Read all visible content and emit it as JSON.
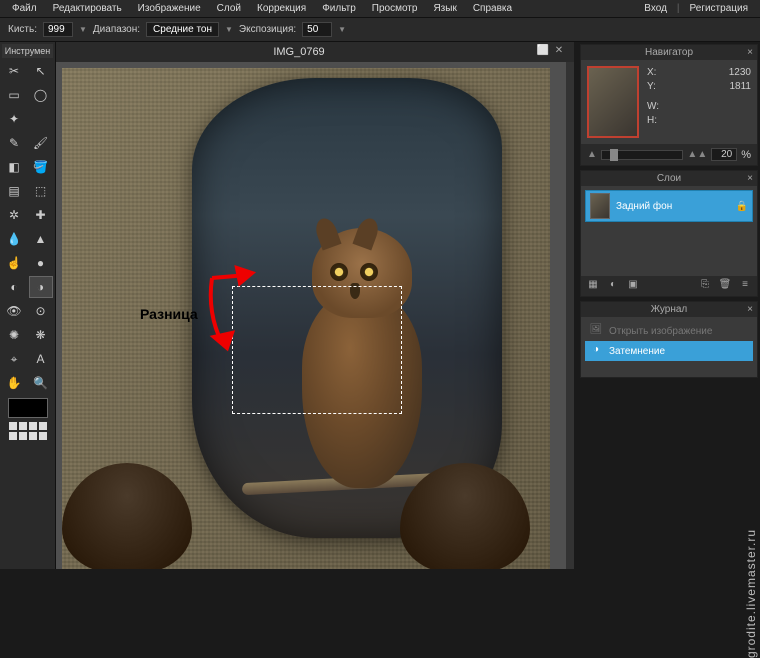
{
  "menus": [
    "Файл",
    "Редактировать",
    "Изображение",
    "Слой",
    "Коррекция",
    "Фильтр",
    "Просмотр",
    "Язык",
    "Справка"
  ],
  "auth": {
    "login": "Вход",
    "reg": "Регистрация"
  },
  "options": {
    "brush_lbl": "Кисть:",
    "brush_val": "999",
    "range_lbl": "Диапазон:",
    "range_val": "Средние тон",
    "exposure_lbl": "Экспозиция:",
    "exposure_val": "50"
  },
  "toolbox_title": "Инструмен",
  "tools": [
    {
      "n": "crop",
      "g": "✂",
      "i": true
    },
    {
      "n": "move",
      "g": "↖",
      "i": true
    },
    {
      "n": "marquee",
      "g": "▭",
      "i": true
    },
    {
      "n": "lasso",
      "g": "◯",
      "i": true
    },
    {
      "n": "wand",
      "g": "✦",
      "i": true
    },
    {
      "n": "blank1",
      "g": "",
      "i": false
    },
    {
      "n": "pencil",
      "g": "✎",
      "i": true
    },
    {
      "n": "brush",
      "g": "🖌",
      "i": true
    },
    {
      "n": "eraser",
      "g": "◧",
      "i": true
    },
    {
      "n": "bucket",
      "g": "🪣",
      "i": true
    },
    {
      "n": "gradient",
      "g": "▤",
      "i": true
    },
    {
      "n": "clone",
      "g": "⬚",
      "i": true
    },
    {
      "n": "stamp",
      "g": "✲",
      "i": true
    },
    {
      "n": "heal",
      "g": "✚",
      "i": true
    },
    {
      "n": "blur",
      "g": "💧",
      "i": true
    },
    {
      "n": "sharpen",
      "g": "▲",
      "i": true
    },
    {
      "n": "smudge",
      "g": "☝",
      "i": true
    },
    {
      "n": "sponge",
      "g": "●",
      "i": true
    },
    {
      "n": "dodge",
      "g": "◐",
      "i": true
    },
    {
      "n": "burn",
      "g": "◑",
      "i": true,
      "active": true
    },
    {
      "n": "eye",
      "g": "👁",
      "i": true
    },
    {
      "n": "redeye",
      "g": "⊙",
      "i": true
    },
    {
      "n": "spot",
      "g": "✺",
      "i": true
    },
    {
      "n": "bloat",
      "g": "❋",
      "i": true
    },
    {
      "n": "picker",
      "g": "⌖",
      "i": true
    },
    {
      "n": "type",
      "g": "A",
      "i": true
    },
    {
      "n": "hand",
      "g": "✋",
      "i": true
    },
    {
      "n": "zoom",
      "g": "🔍",
      "i": true
    }
  ],
  "doc_title": "IMG_0769",
  "annotation": "Разница",
  "navigator": {
    "title": "Навигатор",
    "x_lbl": "X:",
    "x": "1230",
    "y_lbl": "Y:",
    "y": "1811",
    "w_lbl": "W:",
    "h_lbl": "H:",
    "zoom": "20",
    "pct": "%"
  },
  "layers": {
    "title": "Слои",
    "bg": "Задний фон"
  },
  "history": {
    "title": "Журнал",
    "open": "Открыть изображение",
    "burn": "Затемнение"
  },
  "watermark": "grodite.livemaster.ru"
}
